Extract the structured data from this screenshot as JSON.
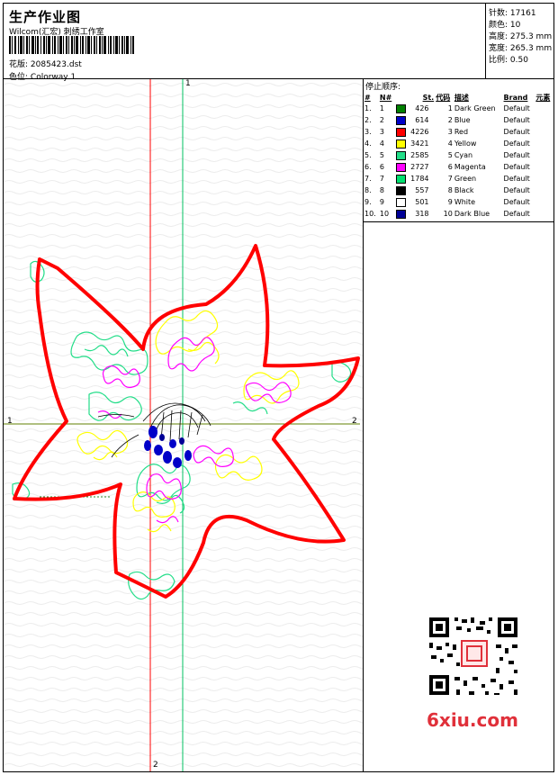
{
  "header": {
    "title": "生产作业图",
    "subtitle": "Wilcom(汇宏) 刺绣工作室",
    "pattern_label": "花版:",
    "pattern_value": "2085423.dst",
    "colorway_label": "色位:",
    "colorway_value": "Colorway 1"
  },
  "stats": [
    {
      "label": "针数:",
      "value": "17161"
    },
    {
      "label": "颜色:",
      "value": "10"
    },
    {
      "label": "高度:",
      "value": "275.3 mm"
    },
    {
      "label": "宽度:",
      "value": "265.3 mm"
    },
    {
      "label": "比例:",
      "value": "0.50"
    }
  ],
  "stop_sequence": {
    "title": "停止顺序:",
    "columns": [
      "#",
      "N#",
      "St.",
      "代码",
      "描述",
      "Brand",
      "元素"
    ],
    "rows": [
      {
        "idx": "1.",
        "n": "1",
        "color": "#008000",
        "stitches": "426",
        "code": "1",
        "desc": "Dark Green",
        "brand": "Default"
      },
      {
        "idx": "2.",
        "n": "2",
        "color": "#0000c8",
        "stitches": "614",
        "code": "2",
        "desc": "Blue",
        "brand": "Default"
      },
      {
        "idx": "3.",
        "n": "3",
        "color": "#ff0000",
        "stitches": "4226",
        "code": "3",
        "desc": "Red",
        "brand": "Default"
      },
      {
        "idx": "4.",
        "n": "4",
        "color": "#ffff00",
        "stitches": "3421",
        "code": "4",
        "desc": "Yellow",
        "brand": "Default"
      },
      {
        "idx": "5.",
        "n": "5",
        "color": "#22dd88",
        "stitches": "2585",
        "code": "5",
        "desc": "Cyan",
        "brand": "Default"
      },
      {
        "idx": "6.",
        "n": "6",
        "color": "#ff00ff",
        "stitches": "2727",
        "code": "6",
        "desc": "Magenta",
        "brand": "Default"
      },
      {
        "idx": "7.",
        "n": "7",
        "color": "#00e070",
        "stitches": "1784",
        "code": "7",
        "desc": "Green",
        "brand": "Default"
      },
      {
        "idx": "8.",
        "n": "8",
        "color": "#000000",
        "stitches": "557",
        "code": "8",
        "desc": "Black",
        "brand": "Default"
      },
      {
        "idx": "9.",
        "n": "9",
        "color": "#ffffff",
        "stitches": "501",
        "code": "9",
        "desc": "White",
        "brand": "Default"
      },
      {
        "idx": "10.",
        "n": "10",
        "color": "#000096",
        "stitches": "318",
        "code": "10",
        "desc": "Dark Blue",
        "brand": "Default"
      }
    ]
  },
  "axes": {
    "top_marker": "1",
    "left_marker": "1",
    "right_marker": "2",
    "bottom_marker": "2"
  },
  "watermark": {
    "logo_text": "6xiu.com"
  },
  "colors": {
    "outline": "#ff0000",
    "vertical_red_axis": "#ff0000",
    "vertical_green_axis": "#00c060",
    "horizontal_axis": "#608000",
    "logo": "#e0303a"
  }
}
